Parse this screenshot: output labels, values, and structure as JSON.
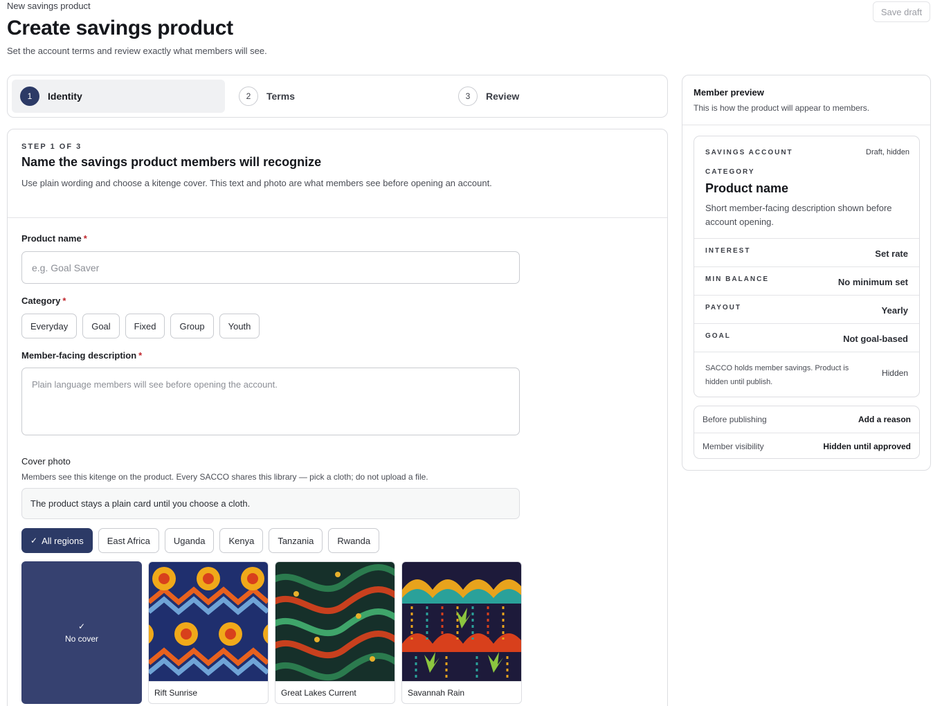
{
  "header": {
    "eyebrow": "New savings product",
    "title": "Create savings product",
    "subtitle": "Set the account terms and review exactly what members will see.",
    "save_draft_label": "Save draft"
  },
  "stepper": {
    "active_index": 0,
    "steps": [
      {
        "num": "1",
        "label": "Identity"
      },
      {
        "num": "2",
        "label": "Terms"
      },
      {
        "num": "3",
        "label": "Review"
      }
    ]
  },
  "form": {
    "step_eyebrow": "STEP 1 OF 3",
    "title": "Name the savings product members will recognize",
    "description": "Use plain wording and choose a kitenge cover. This text and photo are what members see before opening an account.",
    "required_mark": "*",
    "product_name": {
      "label": "Product name",
      "value": "",
      "placeholder": "e.g. Goal Saver"
    },
    "category": {
      "label": "Category",
      "options": [
        "Everyday",
        "Goal",
        "Fixed",
        "Group",
        "Youth"
      ],
      "selected": null
    },
    "member_description": {
      "label": "Member-facing description",
      "value": "",
      "placeholder": "Plain language members will see before opening the account."
    },
    "cover": {
      "label": "Cover photo",
      "help": "Members see this kitenge on the product. Every SACCO shares this library — pick a cloth; do not upload a file.",
      "notice": "The product stays a plain card until you choose a cloth.",
      "region_filters": [
        "All regions",
        "East Africa",
        "Uganda",
        "Kenya",
        "Tanzania",
        "Rwanda"
      ],
      "selected_region": "All regions",
      "check_glyph": "✓",
      "no_cover_label": "No cover",
      "cloths": [
        {
          "name": "Rift Sunrise",
          "icon": "kitenge-sunburst-pattern",
          "colors": [
            "#1f2f6e",
            "#e8611e",
            "#f0a91a"
          ]
        },
        {
          "name": "Great Lakes Current",
          "icon": "kitenge-wave-pattern",
          "colors": [
            "#16302a",
            "#2b7b4e",
            "#c8401e"
          ]
        },
        {
          "name": "Savannah Rain",
          "icon": "kitenge-rain-pattern",
          "colors": [
            "#1d1a3a",
            "#2aa19a",
            "#e8a31c"
          ]
        }
      ]
    }
  },
  "preview": {
    "title": "Member preview",
    "subtitle": "This is how the product will appear to members.",
    "kind": "SAVINGS ACCOUNT",
    "status": "Draft, hidden",
    "category": "CATEGORY",
    "name": "Product name",
    "description": "Short member-facing description shown before account opening.",
    "rows": [
      {
        "key": "INTEREST",
        "value": "Set rate"
      },
      {
        "key": "MIN BALANCE",
        "value": "No minimum set"
      },
      {
        "key": "PAYOUT",
        "value": "Yearly"
      },
      {
        "key": "GOAL",
        "value": "Not goal-based"
      }
    ],
    "note": {
      "text": "SACCO holds member savings. Product is hidden until publish.",
      "value": "Hidden"
    },
    "meta": [
      {
        "key": "Before publishing",
        "value": "Add a reason"
      },
      {
        "key": "Member visibility",
        "value": "Hidden until approved"
      }
    ]
  }
}
